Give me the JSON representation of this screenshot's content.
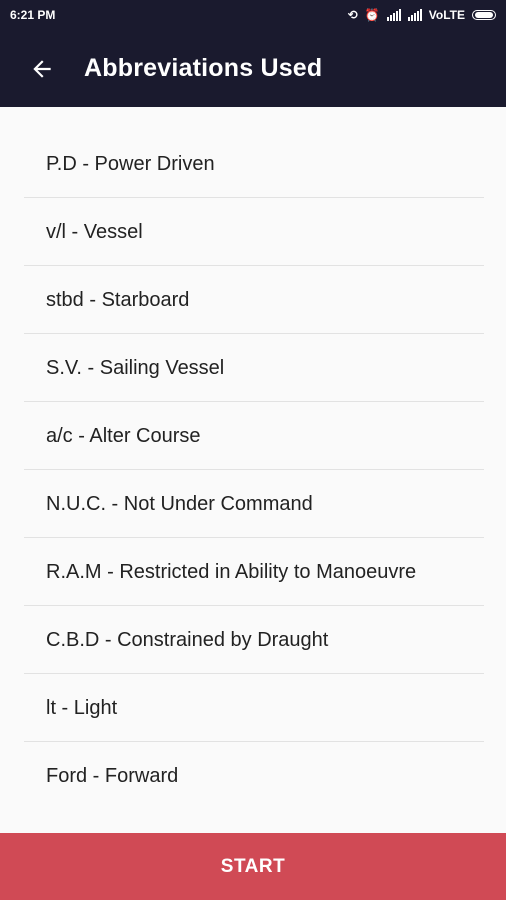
{
  "status_bar": {
    "time": "6:21 PM",
    "network": "VoLTE",
    "icons": [
      "sync-off-icon",
      "alarm-icon",
      "signal-icon",
      "signal-icon",
      "battery-icon"
    ]
  },
  "app_bar": {
    "title": "Abbreviations Used",
    "back_icon": "arrow-back-icon",
    "background": "#1a1a2e"
  },
  "abbreviations": [
    {
      "text": "P.D - Power Driven"
    },
    {
      "text": "v/l - Vessel"
    },
    {
      "text": "stbd - Starboard"
    },
    {
      "text": "S.V. - Sailing Vessel"
    },
    {
      "text": "a/c - Alter Course"
    },
    {
      "text": "N.U.C. - Not Under Command"
    },
    {
      "text": "R.A.M - Restricted in Ability to Manoeuvre"
    },
    {
      "text": "C.B.D - Constrained by Draught"
    },
    {
      "text": "lt - Light"
    },
    {
      "text": "Ford - Forward"
    }
  ],
  "start_button": {
    "label": "START",
    "color": "#d04a55"
  }
}
